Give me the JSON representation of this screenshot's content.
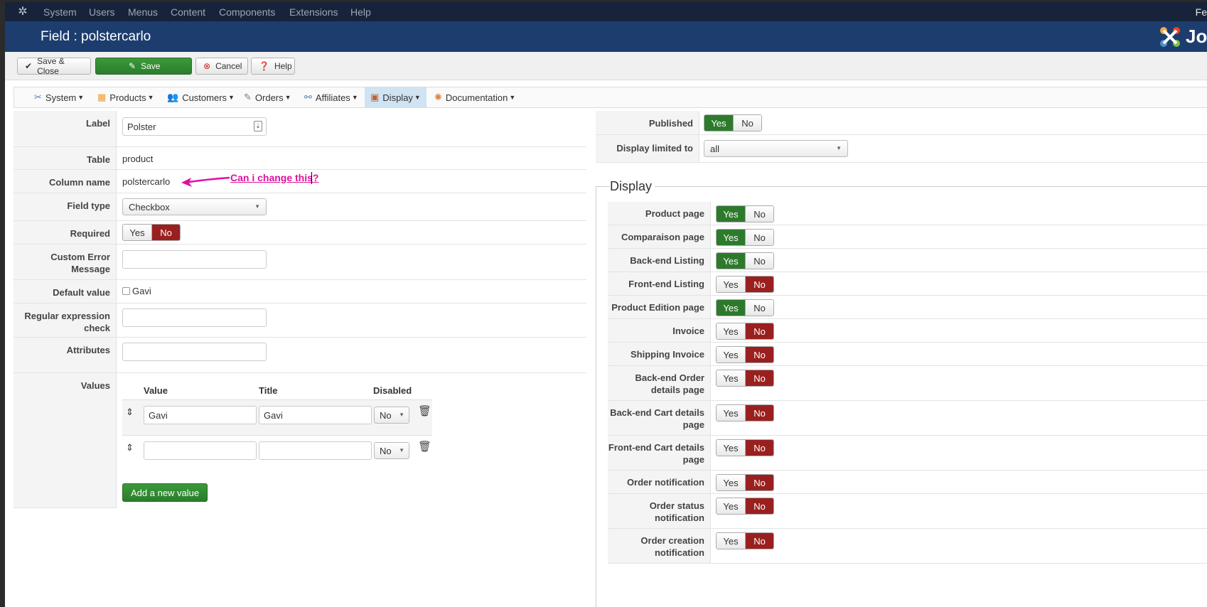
{
  "topnav": {
    "items": [
      "System",
      "Users",
      "Menus",
      "Content",
      "Components",
      "Extensions",
      "Help"
    ],
    "user": "Fe"
  },
  "titlebar": {
    "title": "Field : polstercarlo",
    "brand": "Jo"
  },
  "toolbar": {
    "save_close": "Save & Close",
    "save": "Save",
    "cancel": "Cancel",
    "help": "Help"
  },
  "compnav": {
    "items": [
      {
        "label": "System",
        "icon": "tools-icon"
      },
      {
        "label": "Products",
        "icon": "box-icon"
      },
      {
        "label": "Customers",
        "icon": "users-icon"
      },
      {
        "label": "Orders",
        "icon": "orders-icon"
      },
      {
        "label": "Affiliates",
        "icon": "affiliates-icon"
      },
      {
        "label": "Display",
        "icon": "display-icon"
      },
      {
        "label": "Documentation",
        "icon": "doc-icon"
      }
    ]
  },
  "form": {
    "label": {
      "label": "Label",
      "value": "Polster"
    },
    "table": {
      "label": "Table",
      "value": "product"
    },
    "column_name": {
      "label": "Column name",
      "value": "polstercarlo"
    },
    "field_type": {
      "label": "Field type",
      "value": "Checkbox"
    },
    "required": {
      "label": "Required",
      "yes": "Yes",
      "no": "No"
    },
    "custom_error": {
      "label": "Custom Error Message"
    },
    "default_value": {
      "label": "Default value",
      "option": "Gavi"
    },
    "regex": {
      "label": "Regular expression check"
    },
    "attributes": {
      "label": "Attributes"
    },
    "values": {
      "label": "Values",
      "headers": [
        "Value",
        "Title",
        "Disabled"
      ],
      "rows": [
        {
          "value": "Gavi",
          "title": "Gavi",
          "disabled": "No"
        },
        {
          "value": "",
          "title": "",
          "disabled": "No"
        }
      ],
      "add_button": "Add a new value"
    }
  },
  "annotation": {
    "text": "Can i change this?"
  },
  "right": {
    "published": {
      "label": "Published",
      "yes": "Yes",
      "no": "No"
    },
    "display_limited": {
      "label": "Display limited to",
      "value": "all"
    }
  },
  "display": {
    "legend": "Display",
    "yes": "Yes",
    "no": "No",
    "rows": [
      {
        "label": "Product page",
        "state": "yes"
      },
      {
        "label": "Comparaison page",
        "state": "yes"
      },
      {
        "label": "Back-end Listing",
        "state": "yes"
      },
      {
        "label": "Front-end Listing",
        "state": "no"
      },
      {
        "label": "Product Edition page",
        "state": "yes"
      },
      {
        "label": "Invoice",
        "state": "no"
      },
      {
        "label": "Shipping Invoice",
        "state": "no"
      },
      {
        "label": "Back-end Order details page",
        "state": "no"
      },
      {
        "label": "Back-end Cart details page",
        "state": "no"
      },
      {
        "label": "Front-end Cart details page",
        "state": "no"
      },
      {
        "label": "Order notification",
        "state": "no"
      },
      {
        "label": "Order status notification",
        "state": "no"
      },
      {
        "label": "Order creation notification",
        "state": "no"
      }
    ]
  }
}
